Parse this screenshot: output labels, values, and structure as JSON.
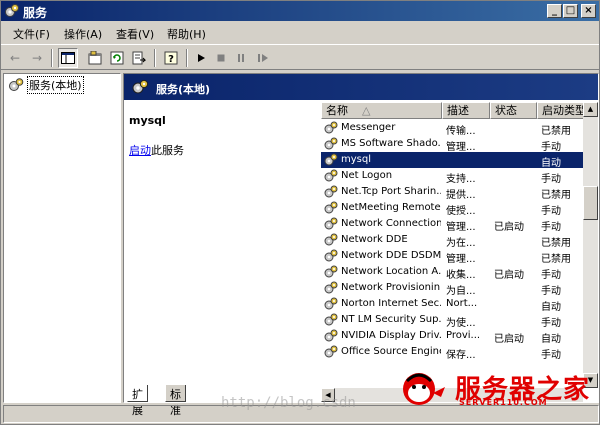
{
  "window": {
    "title": "服务"
  },
  "menu": [
    "文件(F)",
    "操作(A)",
    "查看(V)",
    "帮助(H)"
  ],
  "tree": {
    "root_label": "服务(本地)"
  },
  "panel": {
    "header": "服务(本地)",
    "selected_service": "mysql",
    "start_link": "启动",
    "start_suffix": "此服务"
  },
  "columns": [
    "名称",
    "描述",
    "状态",
    "启动类型"
  ],
  "services": [
    {
      "name": "Messenger",
      "desc": "传输...",
      "status": "",
      "startup": "已禁用"
    },
    {
      "name": "MS Software Shado...",
      "desc": "管理...",
      "status": "",
      "startup": "手动"
    },
    {
      "name": "mysql",
      "desc": "",
      "status": "",
      "startup": "自动",
      "selected": true
    },
    {
      "name": "Net Logon",
      "desc": "支持...",
      "status": "",
      "startup": "手动"
    },
    {
      "name": "Net.Tcp Port Sharin...",
      "desc": "提供...",
      "status": "",
      "startup": "已禁用"
    },
    {
      "name": "NetMeeting Remote...",
      "desc": "使授...",
      "status": "",
      "startup": "手动"
    },
    {
      "name": "Network Connections",
      "desc": "管理...",
      "status": "已启动",
      "startup": "手动"
    },
    {
      "name": "Network DDE",
      "desc": "为在...",
      "status": "",
      "startup": "已禁用"
    },
    {
      "name": "Network DDE DSDM",
      "desc": "管理...",
      "status": "",
      "startup": "已禁用"
    },
    {
      "name": "Network Location A...",
      "desc": "收集...",
      "status": "已启动",
      "startup": "手动"
    },
    {
      "name": "Network Provisionin...",
      "desc": "为自...",
      "status": "",
      "startup": "手动"
    },
    {
      "name": "Norton Internet Sec...",
      "desc": "Nort...",
      "status": "",
      "startup": "自动"
    },
    {
      "name": "NT LM Security Sup...",
      "desc": "为使...",
      "status": "",
      "startup": "手动"
    },
    {
      "name": "NVIDIA Display Driv...",
      "desc": "Provi...",
      "status": "已启动",
      "startup": "自动"
    },
    {
      "name": "Office Source Engine",
      "desc": "保存...",
      "status": "",
      "startup": "手动"
    }
  ],
  "tabs": [
    "扩展",
    "标准"
  ],
  "watermark": "http://blog.csdn",
  "logo": {
    "text": "服务器之家",
    "sub": "SERVER110.COM"
  },
  "colors": {
    "title_gradient_start": "#0a246a",
    "selection": "#0a246a",
    "logo_red": "#e00000"
  }
}
